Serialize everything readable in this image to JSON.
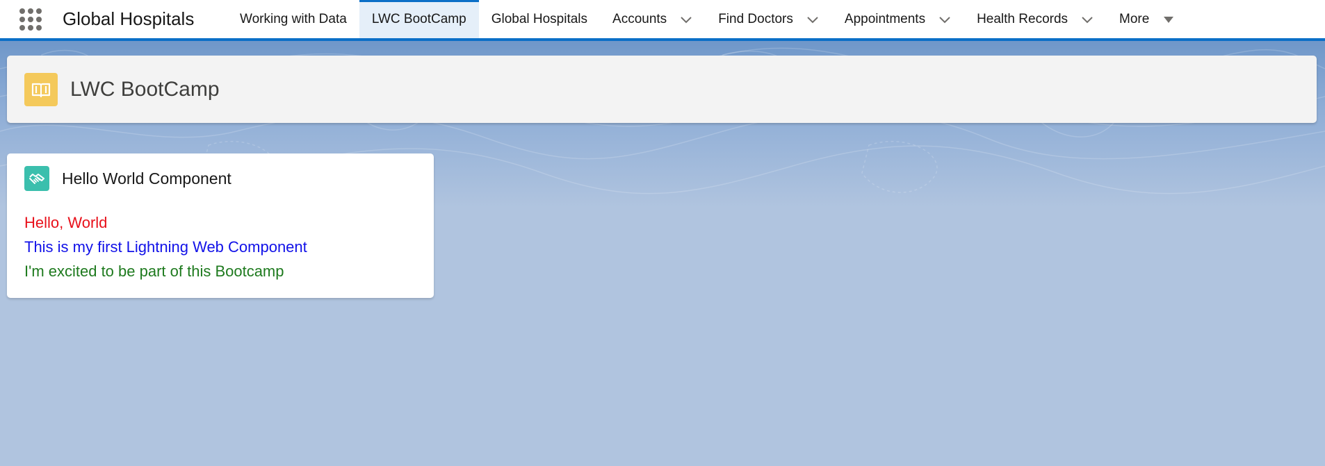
{
  "app": {
    "name": "Global Hospitals"
  },
  "nav": {
    "tabs": [
      {
        "label": "Working with Data",
        "active": false,
        "dropdown": false
      },
      {
        "label": "LWC BootCamp",
        "active": true,
        "dropdown": false
      },
      {
        "label": "Global Hospitals",
        "active": false,
        "dropdown": false
      },
      {
        "label": "Accounts",
        "active": false,
        "dropdown": true
      },
      {
        "label": "Find Doctors",
        "active": false,
        "dropdown": true
      },
      {
        "label": "Appointments",
        "active": false,
        "dropdown": true
      },
      {
        "label": "Health Records",
        "active": false,
        "dropdown": true
      }
    ],
    "more_label": "More"
  },
  "page": {
    "title": "LWC BootCamp",
    "icon": "book-icon"
  },
  "card": {
    "title": "Hello World Component",
    "icon": "handshake-icon",
    "lines": [
      {
        "text": "Hello, World",
        "color": "#e8101a"
      },
      {
        "text": "This is my first Lightning Web Component",
        "color": "#1111e8"
      },
      {
        "text": "I'm excited to be part of this Bootcamp",
        "color": "#1e7a1e"
      }
    ]
  },
  "colors": {
    "accent": "#0b6fc7",
    "page_icon_bg": "#f4c95b",
    "card_icon_bg": "#3bbfad",
    "background": "#b0c4df"
  }
}
